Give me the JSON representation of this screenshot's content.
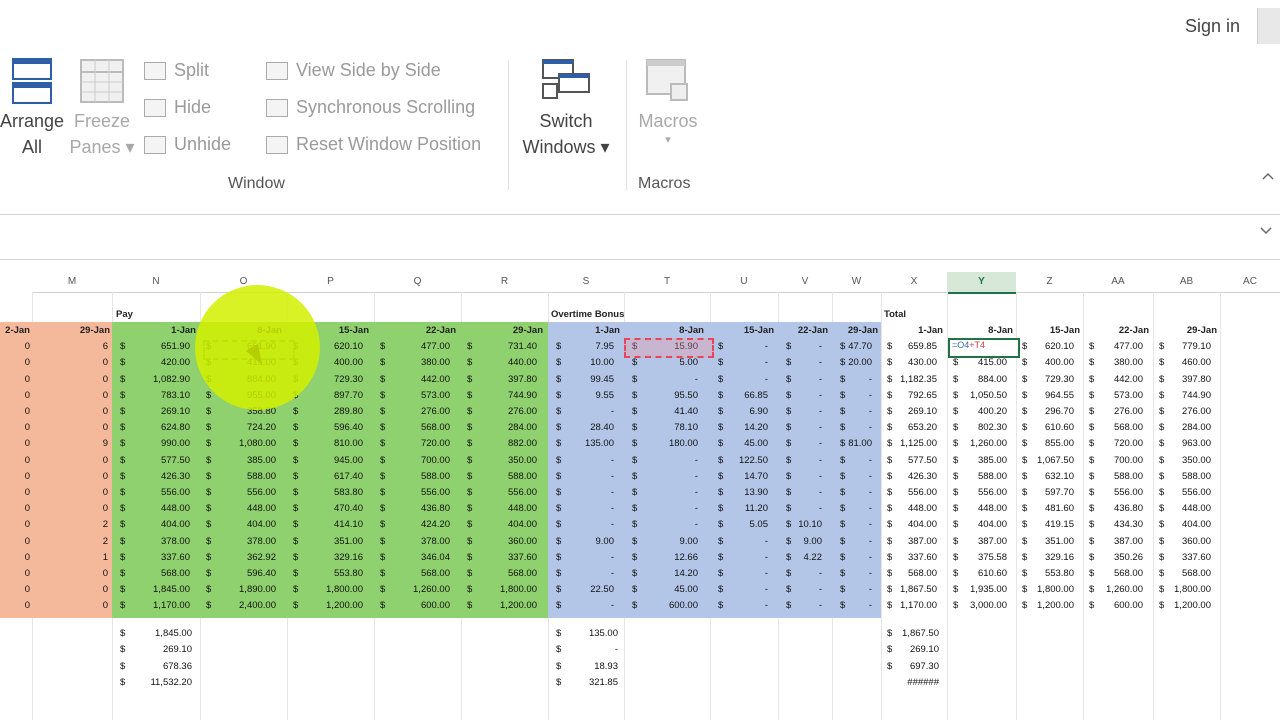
{
  "header": {
    "sign_in": "Sign in"
  },
  "ribbon": {
    "arrange_all": [
      "Arrange",
      "All"
    ],
    "freeze_panes": [
      "Freeze",
      "Panes ▾"
    ],
    "split": "Split",
    "hide": "Hide",
    "unhide": "Unhide",
    "view_side_by_side": "View Side by Side",
    "sync_scrolling": "Synchronous Scrolling",
    "reset_window_position": "Reset Window Position",
    "switch_windows": [
      "Switch",
      "Windows ▾"
    ],
    "macros": "Macros",
    "macros_arrow": "▾",
    "group_window": "Window",
    "group_macros": "Macros"
  },
  "columns": [
    "M",
    "N",
    "O",
    "P",
    "Q",
    "R",
    "S",
    "T",
    "U",
    "V",
    "W",
    "X",
    "Y",
    "Z",
    "AA",
    "AB",
    "AC"
  ],
  "selected_column": "Y",
  "section_labels": {
    "pay": "Pay",
    "overtime": "Overtime Bonus",
    "total": "Total"
  },
  "date_headers": {
    "left": [
      "2-Jan",
      "29-Jan"
    ],
    "pay": [
      "1-Jan",
      "8-Jan",
      "15-Jan",
      "22-Jan",
      "29-Jan"
    ],
    "overtime": [
      "1-Jan",
      "8-Jan",
      "15-Jan",
      "22-Jan",
      "29-Jan"
    ],
    "total": [
      "1-Jan",
      "8-Jan",
      "15-Jan",
      "22-Jan",
      "29-Jan"
    ]
  },
  "edit_formula": {
    "part1": "=O4",
    "part2": "+T4"
  },
  "colors": {
    "orange": "#f4b89a",
    "green": "#8fd16e",
    "blue": "#b3c6e8",
    "selected": "#217346"
  },
  "rows": [
    {
      "l": [
        "0",
        "6"
      ],
      "pay": [
        "651.90",
        "651.90",
        "620.10",
        "477.00",
        "731.40"
      ],
      "ot": [
        "7.95",
        "15.90",
        "-",
        "-",
        "47.70"
      ],
      "tot": [
        "659.85",
        "",
        "620.10",
        "477.00",
        "779.10"
      ]
    },
    {
      "l": [
        "0",
        "0"
      ],
      "pay": [
        "420.00",
        "415.00",
        "400.00",
        "380.00",
        "440.00"
      ],
      "ot": [
        "10.00",
        "5.00",
        "-",
        "-",
        "20.00"
      ],
      "tot": [
        "430.00",
        "415.00",
        "400.00",
        "380.00",
        "460.00"
      ]
    },
    {
      "l": [
        "0",
        "0"
      ],
      "pay": [
        "1,082.90",
        "884.00",
        "729.30",
        "442.00",
        "397.80"
      ],
      "ot": [
        "99.45",
        "-",
        "-",
        "-",
        "-"
      ],
      "tot": [
        "1,182.35",
        "884.00",
        "729.30",
        "442.00",
        "397.80"
      ]
    },
    {
      "l": [
        "0",
        "0"
      ],
      "pay": [
        "783.10",
        "955.00",
        "897.70",
        "573.00",
        "744.90"
      ],
      "ot": [
        "9.55",
        "95.50",
        "66.85",
        "-",
        "-"
      ],
      "tot": [
        "792.65",
        "1,050.50",
        "964.55",
        "573.00",
        "744.90"
      ]
    },
    {
      "l": [
        "0",
        "0"
      ],
      "pay": [
        "269.10",
        "358.80",
        "289.80",
        "276.00",
        "276.00"
      ],
      "ot": [
        "-",
        "41.40",
        "6.90",
        "-",
        "-"
      ],
      "tot": [
        "269.10",
        "400.20",
        "296.70",
        "276.00",
        "276.00"
      ]
    },
    {
      "l": [
        "0",
        "0"
      ],
      "pay": [
        "624.80",
        "724.20",
        "596.40",
        "568.00",
        "284.00"
      ],
      "ot": [
        "28.40",
        "78.10",
        "14.20",
        "-",
        "-"
      ],
      "tot": [
        "653.20",
        "802.30",
        "610.60",
        "568.00",
        "284.00"
      ]
    },
    {
      "l": [
        "0",
        "9"
      ],
      "pay": [
        "990.00",
        "1,080.00",
        "810.00",
        "720.00",
        "882.00"
      ],
      "ot": [
        "135.00",
        "180.00",
        "45.00",
        "-",
        "81.00"
      ],
      "tot": [
        "1,125.00",
        "1,260.00",
        "855.00",
        "720.00",
        "963.00"
      ]
    },
    {
      "l": [
        "0",
        "0"
      ],
      "pay": [
        "577.50",
        "385.00",
        "945.00",
        "700.00",
        "350.00"
      ],
      "ot": [
        "-",
        "-",
        "122.50",
        "-",
        "-"
      ],
      "tot": [
        "577.50",
        "385.00",
        "1,067.50",
        "700.00",
        "350.00"
      ]
    },
    {
      "l": [
        "0",
        "0"
      ],
      "pay": [
        "426.30",
        "588.00",
        "617.40",
        "588.00",
        "588.00"
      ],
      "ot": [
        "-",
        "-",
        "14.70",
        "-",
        "-"
      ],
      "tot": [
        "426.30",
        "588.00",
        "632.10",
        "588.00",
        "588.00"
      ]
    },
    {
      "l": [
        "0",
        "0"
      ],
      "pay": [
        "556.00",
        "556.00",
        "583.80",
        "556.00",
        "556.00"
      ],
      "ot": [
        "-",
        "-",
        "13.90",
        "-",
        "-"
      ],
      "tot": [
        "556.00",
        "556.00",
        "597.70",
        "556.00",
        "556.00"
      ]
    },
    {
      "l": [
        "0",
        "0"
      ],
      "pay": [
        "448.00",
        "448.00",
        "470.40",
        "436.80",
        "448.00"
      ],
      "ot": [
        "-",
        "-",
        "11.20",
        "-",
        "-"
      ],
      "tot": [
        "448.00",
        "448.00",
        "481.60",
        "436.80",
        "448.00"
      ]
    },
    {
      "l": [
        "0",
        "2"
      ],
      "pay": [
        "404.00",
        "404.00",
        "414.10",
        "424.20",
        "404.00"
      ],
      "ot": [
        "-",
        "-",
        "5.05",
        "10.10",
        "-"
      ],
      "tot": [
        "404.00",
        "404.00",
        "419.15",
        "434.30",
        "404.00"
      ]
    },
    {
      "l": [
        "0",
        "2"
      ],
      "pay": [
        "378.00",
        "378.00",
        "351.00",
        "378.00",
        "360.00"
      ],
      "ot": [
        "9.00",
        "9.00",
        "-",
        "9.00",
        "-"
      ],
      "tot": [
        "387.00",
        "387.00",
        "351.00",
        "387.00",
        "360.00"
      ]
    },
    {
      "l": [
        "0",
        "1"
      ],
      "pay": [
        "337.60",
        "362.92",
        "329.16",
        "346.04",
        "337.60"
      ],
      "ot": [
        "-",
        "12.66",
        "-",
        "4.22",
        "-"
      ],
      "tot": [
        "337.60",
        "375.58",
        "329.16",
        "350.26",
        "337.60"
      ]
    },
    {
      "l": [
        "0",
        "0"
      ],
      "pay": [
        "568.00",
        "596.40",
        "553.80",
        "568.00",
        "568.00"
      ],
      "ot": [
        "-",
        "14.20",
        "-",
        "-",
        "-"
      ],
      "tot": [
        "568.00",
        "610.60",
        "553.80",
        "568.00",
        "568.00"
      ]
    },
    {
      "l": [
        "0",
        "0"
      ],
      "pay": [
        "1,845.00",
        "1,890.00",
        "1,800.00",
        "1,260.00",
        "1,800.00"
      ],
      "ot": [
        "22.50",
        "45.00",
        "-",
        "-",
        "-"
      ],
      "tot": [
        "1,867.50",
        "1,935.00",
        "1,800.00",
        "1,260.00",
        "1,800.00"
      ]
    },
    {
      "l": [
        "0",
        "0"
      ],
      "pay": [
        "1,170.00",
        "2,400.00",
        "1,200.00",
        "600.00",
        "1,200.00"
      ],
      "ot": [
        "-",
        "600.00",
        "-",
        "-",
        "-"
      ],
      "tot": [
        "1,170.00",
        "3,000.00",
        "1,200.00",
        "600.00",
        "1,200.00"
      ]
    }
  ],
  "summary": {
    "pay": [
      "1,845.00",
      "269.10",
      "678.36",
      "11,532.20"
    ],
    "ot": [
      "135.00",
      "-",
      "18.93",
      "321.85"
    ],
    "tot": [
      "1,867.50",
      "269.10",
      "697.30",
      "######"
    ]
  }
}
